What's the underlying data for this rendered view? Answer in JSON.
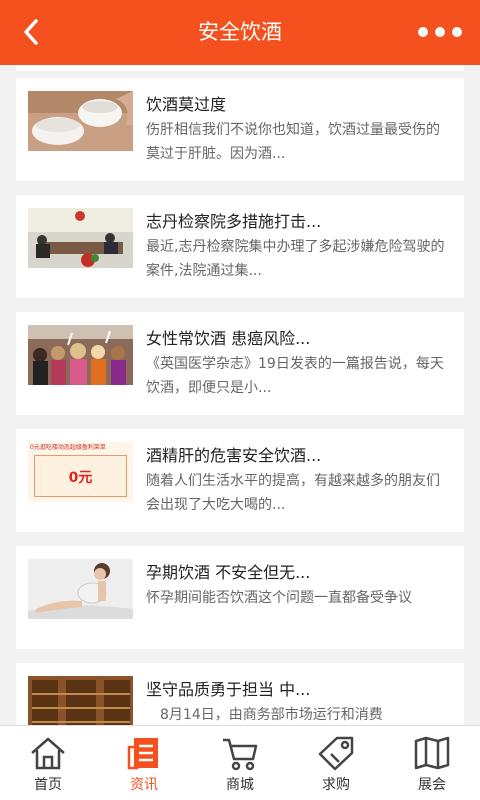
{
  "header": {
    "title": "安全饮酒",
    "back_icon": "chevron-left-icon",
    "more_icon": "more-dots-icon",
    "color": "#f4511e"
  },
  "articles": [
    {
      "title": "饮酒莫过度",
      "desc": "伤肝相信我们不说你也知道，饮酒过量最受伤的莫过于肝脏。因为酒...",
      "thumb": "cups-photo"
    },
    {
      "title": "志丹检察院多措施打击...",
      "desc": "最近,志丹检察院集中办理了多起涉嫌危险驾驶的案件,法院通过集...",
      "thumb": "meeting-photo"
    },
    {
      "title": "女性常饮酒 患癌风险...",
      "desc": "《英国医学杂志》19日发表的一篇报告说，每天饮酒，即便只是小...",
      "thumb": "party-photo"
    },
    {
      "title": "酒精肝的危害安全饮酒...",
      "desc": "随着人们生活水平的提高，有越来越多的朋友们会出现了大吃大喝的...",
      "thumb": "coupon-image"
    },
    {
      "title": "孕期饮酒 不安全但无...",
      "desc": "怀孕期间能否饮酒这个问题一直都备受争议",
      "thumb": "pregnant-woman-photo"
    },
    {
      "title": "坚守品质勇于担当 中...",
      "desc": "　8月14日，由商务部市场运行和消费",
      "thumb": "wine-cellar-photo"
    }
  ],
  "coupon": {
    "banner": "0元逛吃楼动态超级盈利菜单",
    "amount": "0元"
  },
  "tabs": [
    {
      "label": "首页",
      "icon": "home-icon",
      "active": false
    },
    {
      "label": "资讯",
      "icon": "news-icon",
      "active": true
    },
    {
      "label": "商城",
      "icon": "cart-icon",
      "active": false
    },
    {
      "label": "求购",
      "icon": "tag-icon",
      "active": false
    },
    {
      "label": "展会",
      "icon": "map-icon",
      "active": false
    }
  ]
}
